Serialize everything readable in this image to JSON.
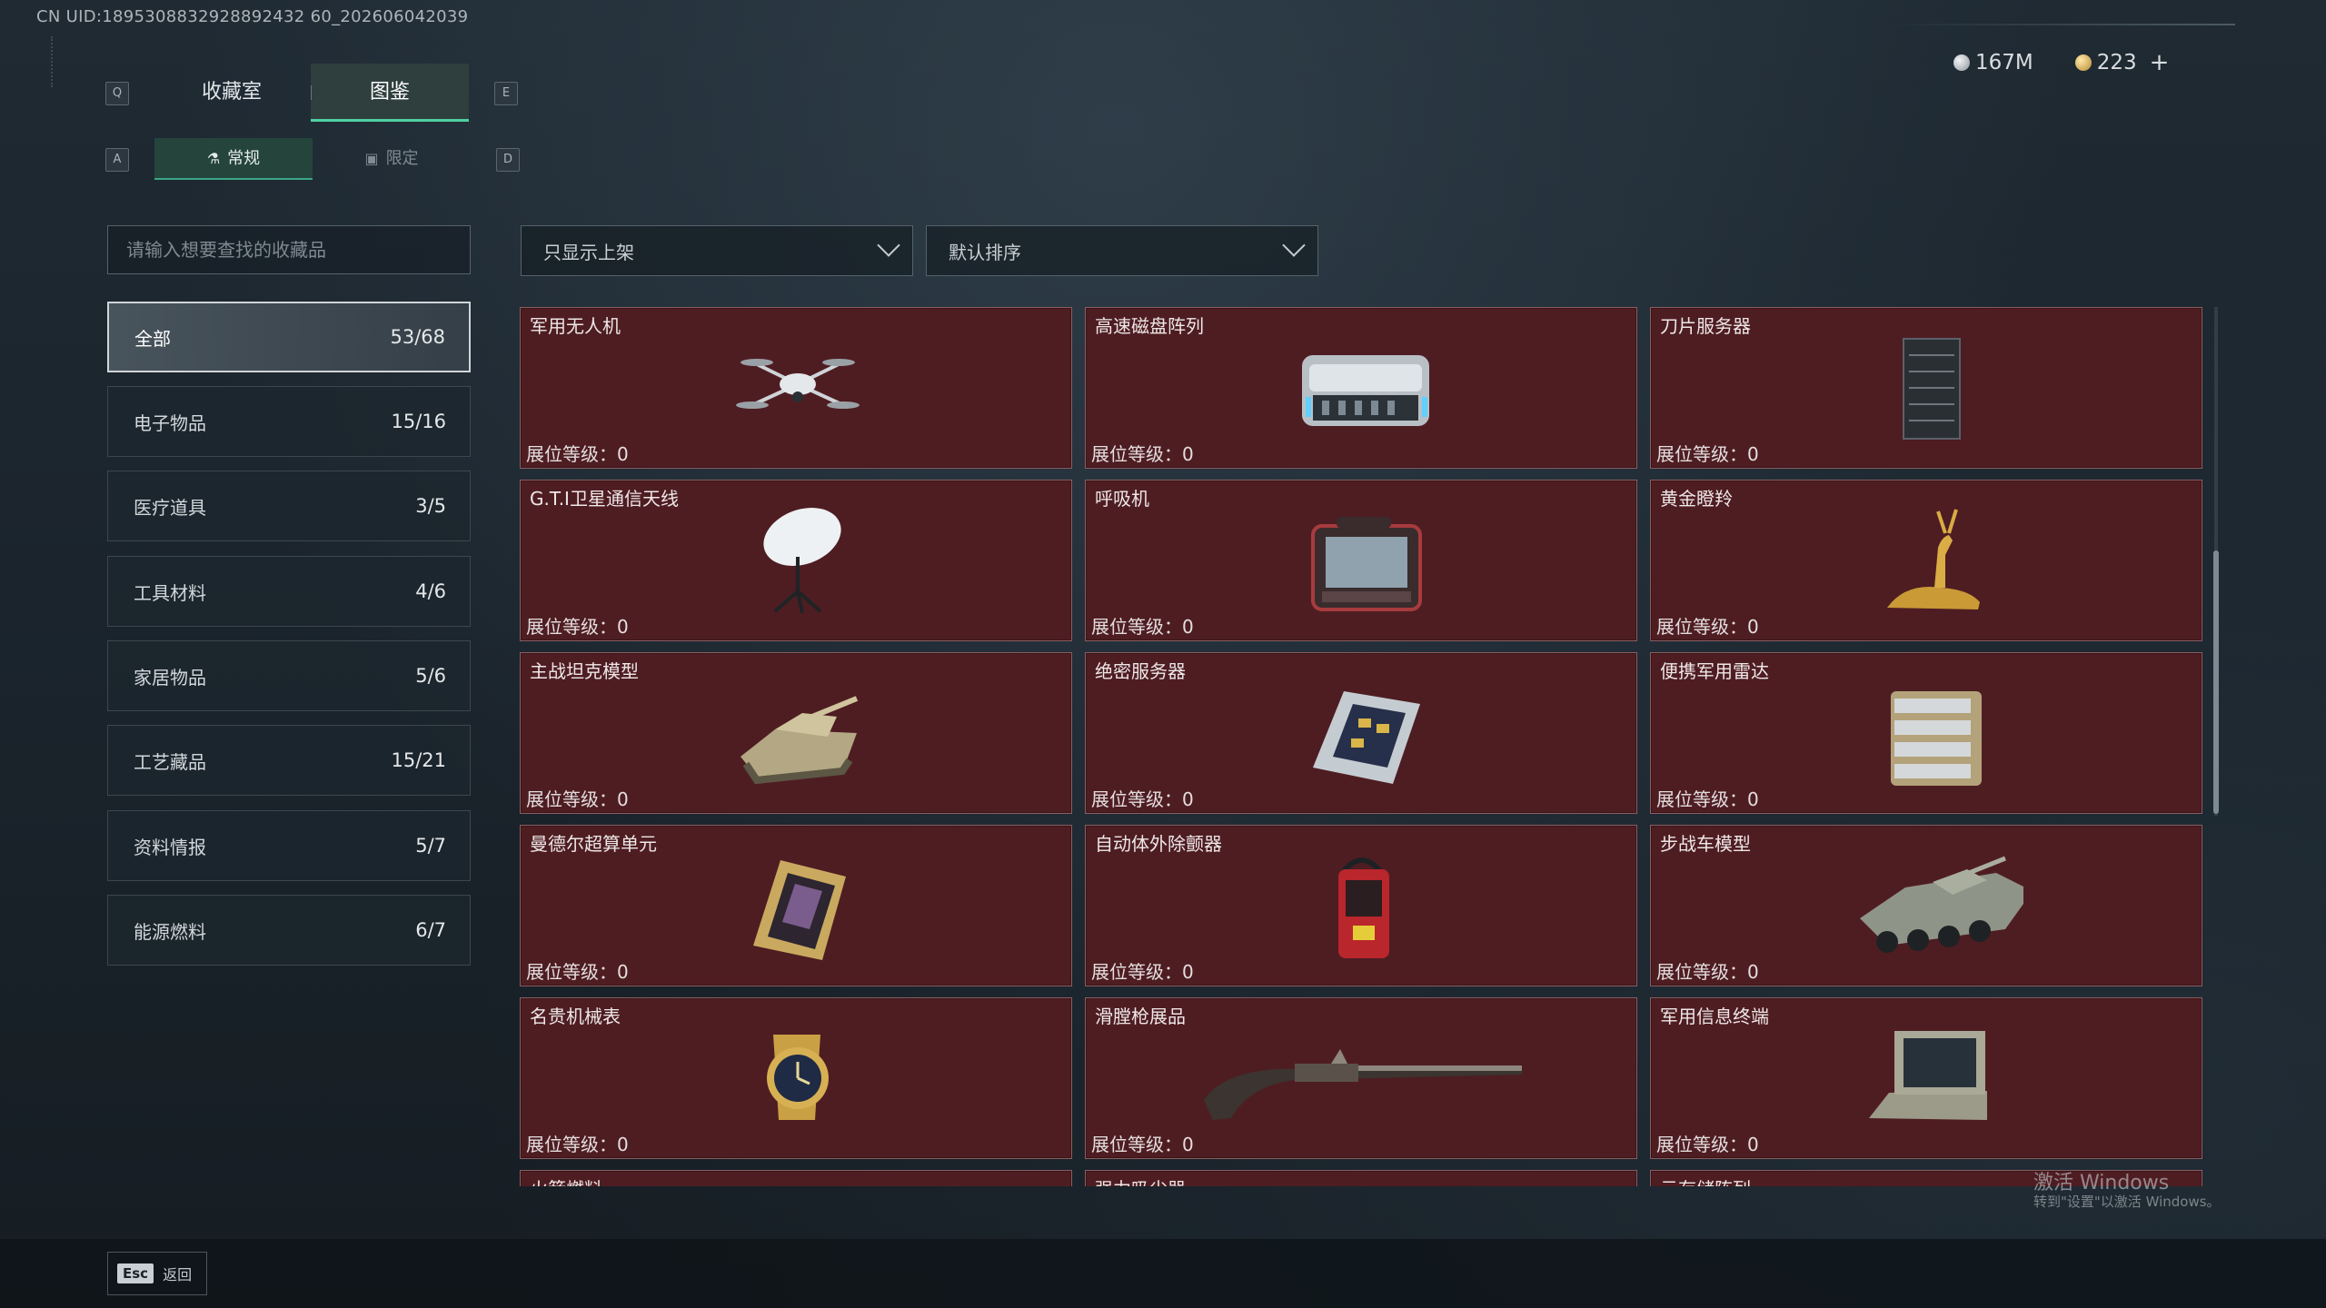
{
  "uid_text": "CN UID:1895308832928892432 60_202606042039",
  "keys": {
    "q": "Q",
    "e": "E",
    "a": "A",
    "d": "D"
  },
  "tabs": [
    {
      "label": "收藏室"
    },
    {
      "label": "图鉴"
    }
  ],
  "subtabs": [
    {
      "label": "常规",
      "icon": "flask-icon"
    },
    {
      "label": "限定",
      "icon": "image-icon"
    }
  ],
  "currency": {
    "silver": "167M",
    "gold": "223",
    "add": "+"
  },
  "search": {
    "placeholder": "请输入想要查找的收藏品"
  },
  "categories": [
    {
      "label": "全部",
      "count": "53/68"
    },
    {
      "label": "电子物品",
      "count": "15/16"
    },
    {
      "label": "医疗道具",
      "count": "3/5"
    },
    {
      "label": "工具材料",
      "count": "4/6"
    },
    {
      "label": "家居物品",
      "count": "5/6"
    },
    {
      "label": "工艺藏品",
      "count": "15/21"
    },
    {
      "label": "资料情报",
      "count": "5/7"
    },
    {
      "label": "能源燃料",
      "count": "6/7"
    }
  ],
  "filters": {
    "display": "只显示上架",
    "sort": "默认排序"
  },
  "level_label": "展位等级：0",
  "items": [
    {
      "name": "军用无人机",
      "icon": "drone-icon"
    },
    {
      "name": "高速磁盘阵列",
      "icon": "disk-array-icon"
    },
    {
      "name": "刀片服务器",
      "icon": "blade-server-icon"
    },
    {
      "name": "G.T.I卫星通信天线",
      "icon": "satellite-dish-icon"
    },
    {
      "name": "呼吸机",
      "icon": "ventilator-icon"
    },
    {
      "name": "黄金瞪羚",
      "icon": "golden-gazelle-icon"
    },
    {
      "name": "主战坦克模型",
      "icon": "tank-model-icon"
    },
    {
      "name": "绝密服务器",
      "icon": "secret-server-icon"
    },
    {
      "name": "便携军用雷达",
      "icon": "radar-icon"
    },
    {
      "name": "曼德尔超算单元",
      "icon": "supercompute-unit-icon"
    },
    {
      "name": "自动体外除颤器",
      "icon": "defibrillator-icon"
    },
    {
      "name": "步战车模型",
      "icon": "ifv-model-icon"
    },
    {
      "name": "名贵机械表",
      "icon": "watch-icon"
    },
    {
      "name": "滑膛枪展品",
      "icon": "musket-icon"
    },
    {
      "name": "军用信息终端",
      "icon": "terminal-icon"
    },
    {
      "name": "火箭燃料",
      "icon": "rocket-fuel-icon"
    },
    {
      "name": "强力吸尘器",
      "icon": "vacuum-icon"
    },
    {
      "name": "云存储阵列",
      "icon": "cloud-storage-icon"
    }
  ],
  "footer": {
    "esc_key": "Esc",
    "esc_label": "返回"
  },
  "watermark": {
    "line1": "激活 Windows",
    "line2": "转到\"设置\"以激活 Windows。"
  },
  "colors": {
    "accent": "#4fd1a1",
    "card_bg": "#4e1d22",
    "card_border": "#8a5e62"
  }
}
